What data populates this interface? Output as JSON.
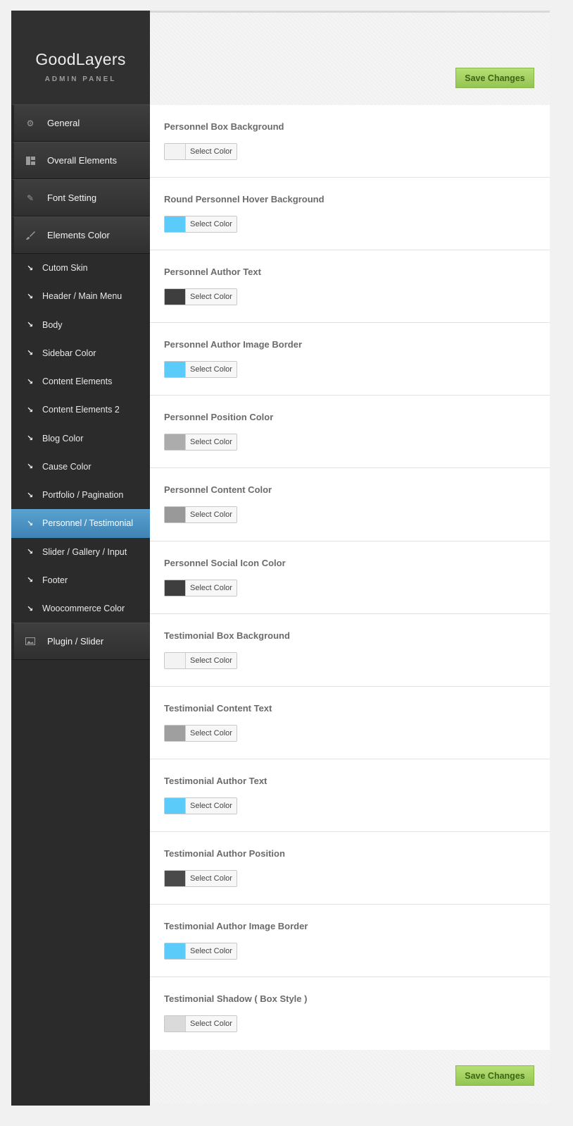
{
  "brand": {
    "title": "GoodLayers",
    "subtitle": "ADMIN PANEL"
  },
  "sidebar": {
    "top_items": [
      {
        "label": "General",
        "icon": "gear-icon"
      },
      {
        "label": "Overall Elements",
        "icon": "layout-icon"
      },
      {
        "label": "Font Setting",
        "icon": "pencil-icon"
      },
      {
        "label": "Elements Color",
        "icon": "brush-icon"
      }
    ],
    "sub_items": [
      {
        "label": "Cutom Skin"
      },
      {
        "label": "Header / Main Menu"
      },
      {
        "label": "Body"
      },
      {
        "label": "Sidebar Color"
      },
      {
        "label": "Content Elements"
      },
      {
        "label": "Content Elements 2"
      },
      {
        "label": "Blog Color"
      },
      {
        "label": "Cause Color"
      },
      {
        "label": "Portfolio / Pagination"
      },
      {
        "label": "Personnel / Testimonial",
        "active": true
      },
      {
        "label": "Slider / Gallery / Input"
      },
      {
        "label": "Footer"
      },
      {
        "label": "Woocommerce Color"
      }
    ],
    "bottom_item": {
      "label": "Plugin / Slider",
      "icon": "image-icon"
    }
  },
  "actions": {
    "save_label": "Save Changes"
  },
  "picker": {
    "label": "Select Color"
  },
  "settings": [
    {
      "label": "Personnel Box Background",
      "color": "#f3f3f3"
    },
    {
      "label": "Round Personnel Hover Background",
      "color": "#5bcbfa"
    },
    {
      "label": "Personnel Author Text",
      "color": "#3e3e3e"
    },
    {
      "label": "Personnel Author Image Border",
      "color": "#5bcbfa"
    },
    {
      "label": "Personnel Position Color",
      "color": "#acacac"
    },
    {
      "label": "Personnel Content Color",
      "color": "#999999"
    },
    {
      "label": "Personnel Social Icon Color",
      "color": "#3e3e3e"
    },
    {
      "label": "Testimonial Box Background",
      "color": "#f3f3f3"
    },
    {
      "label": "Testimonial Content Text",
      "color": "#9f9f9f"
    },
    {
      "label": "Testimonial Author Text",
      "color": "#5bcbfa"
    },
    {
      "label": "Testimonial Author Position",
      "color": "#4a4a4a"
    },
    {
      "label": "Testimonial Author Image Border",
      "color": "#5bcbfa"
    },
    {
      "label": "Testimonial Shadow ( Box Style )",
      "color": "#dadada"
    }
  ]
}
